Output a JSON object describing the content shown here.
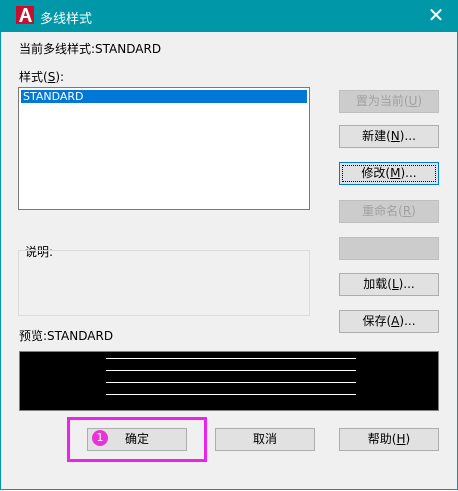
{
  "window": {
    "title": "多线样式"
  },
  "current_style": {
    "label": "当前多线样式:STANDARD"
  },
  "styles": {
    "label_prefix": "样式(",
    "label_key": "S",
    "label_suffix": "):",
    "items": [
      "STANDARD"
    ]
  },
  "description": {
    "label": "说明:"
  },
  "preview": {
    "label": "预览:STANDARD"
  },
  "buttons": {
    "set_current": {
      "prefix": "置为当前(",
      "key": "U",
      "suffix": ")"
    },
    "new": {
      "prefix": "新建(",
      "key": "N",
      "suffix": ")..."
    },
    "modify": {
      "prefix": "修改(",
      "key": "M",
      "suffix": ")..."
    },
    "rename": {
      "prefix": "重命名(",
      "key": "R",
      "suffix": ")"
    },
    "load": {
      "prefix": "加载(",
      "key": "L",
      "suffix": ")..."
    },
    "save": {
      "prefix": "保存(",
      "key": "A",
      "suffix": ")..."
    },
    "ok": "确定",
    "cancel": "取消",
    "help": {
      "prefix": "帮助(",
      "key": "H",
      "suffix": ")"
    }
  },
  "annotation": {
    "step": "1",
    "color": "#ee22ee"
  },
  "colors": {
    "titlebar": "#0098a8",
    "selection": "#0078d7",
    "preview_bg": "#000000"
  },
  "icons": {
    "app": "autocad-a-icon",
    "close": "close-icon"
  }
}
